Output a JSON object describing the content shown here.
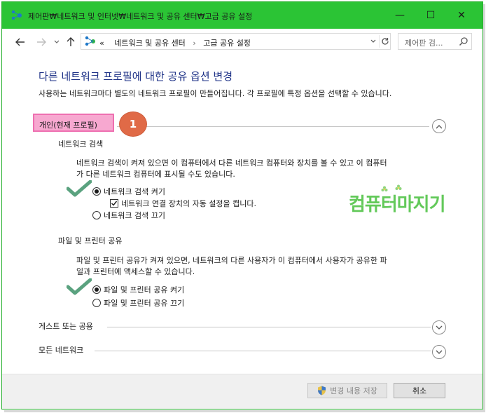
{
  "window": {
    "title": "제어판₩네트워크 및 인터넷₩네트워크 및 공유 센터₩고급 공유 설정",
    "minimize_label": "—",
    "maximize_label": "☐",
    "close_label": "✕",
    "accent_color": "#2bc435"
  },
  "address_bar": {
    "overflow": "«",
    "crumbs": [
      "네트워크 및 공유 센터",
      "고급 공유 설정"
    ],
    "separator": "›",
    "search_placeholder": "제어판 검..."
  },
  "page": {
    "heading": "다른 네트워크 프로필에 대한 공유 옵션 변경",
    "description": "사용하는 네트워크마다 별도의 네트워크 프로필이 만들어집니다. 각 프로필에 특정 옵션을 선택할 수 있습니다."
  },
  "profiles": {
    "private": {
      "label": "개인(현재 프로필)",
      "badge": "1",
      "network_discovery": {
        "title": "네트워크 검색",
        "text_line1": "네트워크 검색이 켜져 있으면 이 컴퓨터에서 다른 네트워크 컴퓨터와 장치를 볼 수 있고 이 컴퓨터",
        "text_line2": "가 다른 네트워크 컴퓨터에 표시될 수도 있습니다.",
        "option_on": "네트워크 검색 켜기",
        "option_auto": "네트워크 연결 장치의 자동 설정을 켭니다.",
        "option_off": "네트워크 검색 끄기",
        "selected": "on",
        "auto_checked": true
      },
      "file_sharing": {
        "title": "파일 및 프린터 공유",
        "text_line1": "파일 및 프린터 공유가 켜져 있으면, 네트워크의 다른 사용자가 이 컴퓨터에서 사용자가 공유한 파",
        "text_line2": "일과 프린터에 액세스할 수 있습니다.",
        "option_on": "파일 및 프린터 공유 켜기",
        "option_off": "파일 및 프린터 공유 끄기",
        "selected": "on"
      }
    },
    "guest": {
      "label": "게스트 또는 공용"
    },
    "all": {
      "label": "모든 네트워크"
    }
  },
  "watermark": {
    "text": "컴퓨터마지기"
  },
  "footer": {
    "save_label": "변경 내용 저장",
    "cancel_label": "취소"
  }
}
